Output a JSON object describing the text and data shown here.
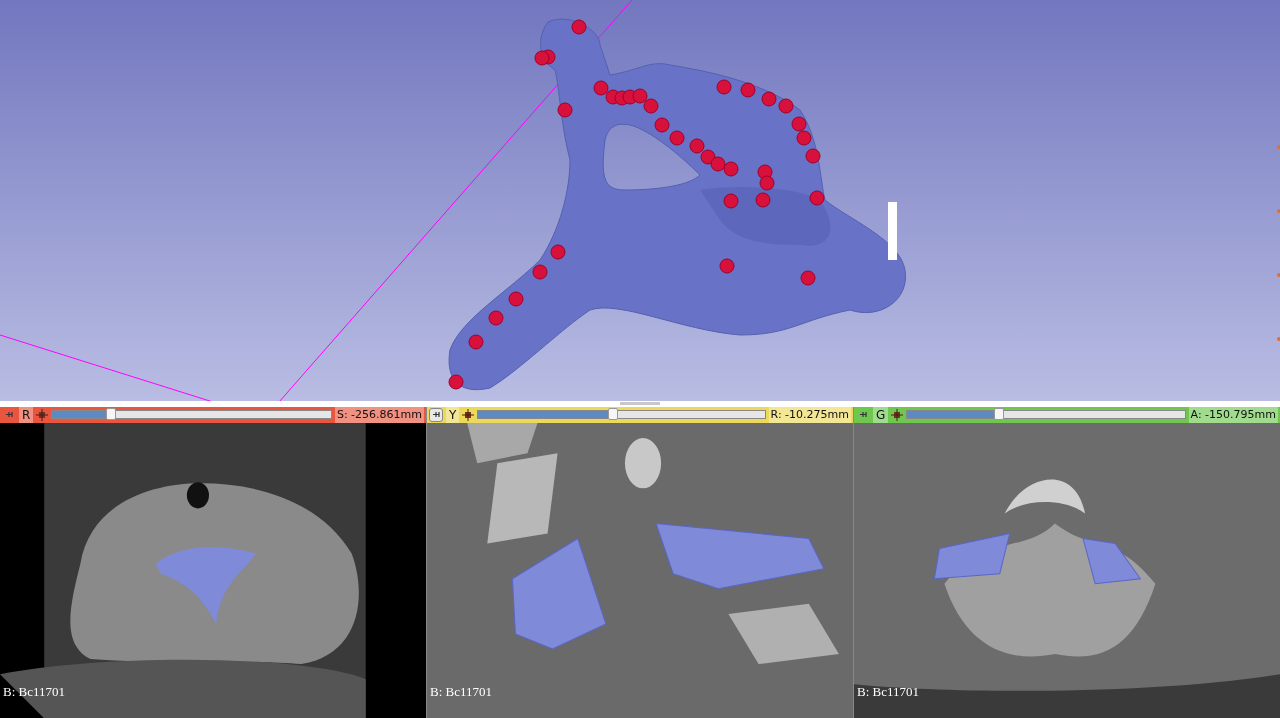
{
  "view_3d": {
    "kind": "model"
  },
  "slice_views": [
    {
      "label": "R",
      "color": "#e9553f",
      "pin_highlighted": false,
      "level": 0.21,
      "offset": "S: -256.861mm",
      "background": "B: Bc11701",
      "kind": "axial"
    },
    {
      "label": "Y",
      "color": "#ecd95a",
      "pin_highlighted": true,
      "level": 0.47,
      "offset": "R: -10.275mm",
      "background": "B: Bc11701",
      "kind": "sagittal"
    },
    {
      "label": "G",
      "color": "#6fc750",
      "pin_highlighted": false,
      "level": 0.33,
      "offset": "A: -150.795mm",
      "background": "B: Bc11701",
      "kind": "coronal"
    }
  ]
}
